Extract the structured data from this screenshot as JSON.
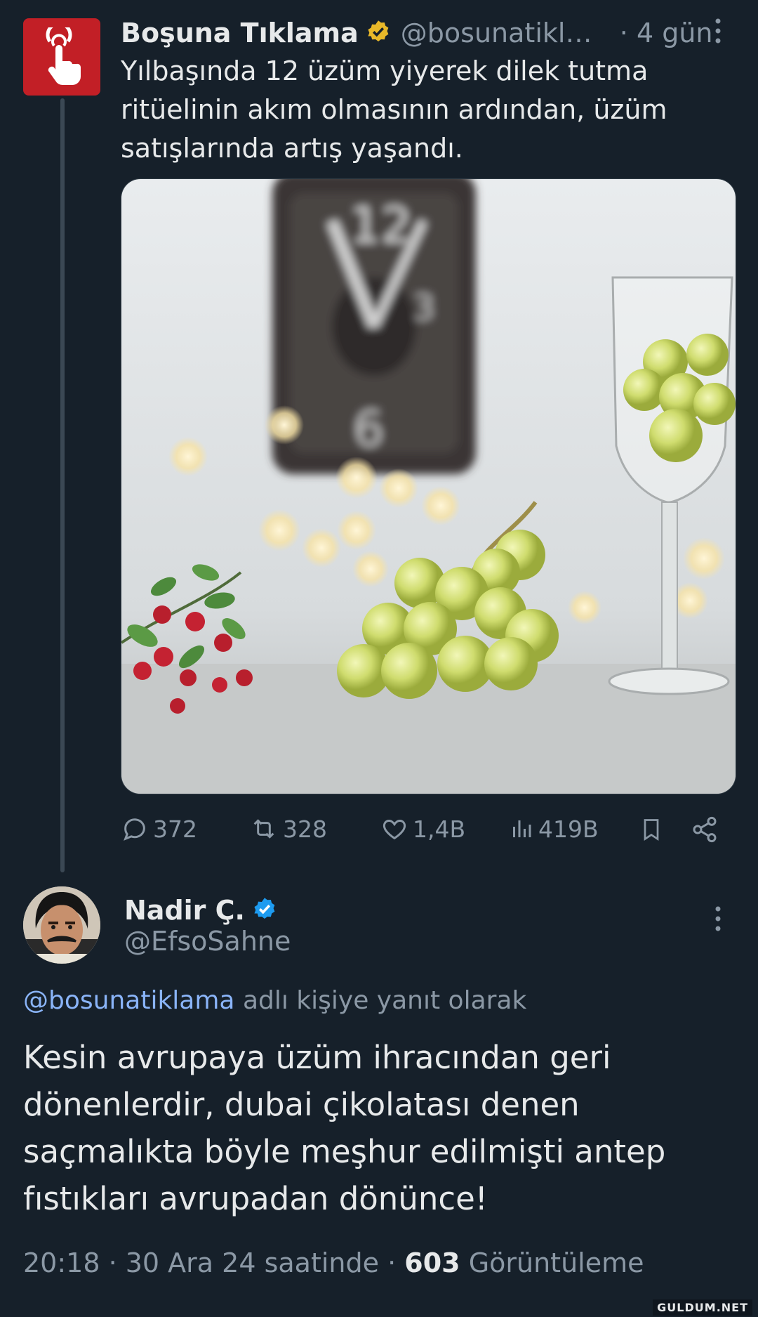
{
  "tweet": {
    "author_name": "Boşuna Tıklama",
    "author_handle": "@bosunatikla...",
    "time": "· 4 gün",
    "text": "Yılbaşında 12 üzüm yiyerek dilek tutma ritüelinin akım olmasının ardından, üzüm satışlarında artış yaşandı.",
    "verified_badge_color": "#e8b829",
    "avatar_color": "#c21f26",
    "stats": {
      "replies": "372",
      "retweets": "328",
      "likes": "1,4B",
      "views": "419B"
    },
    "icons": [
      "hand-pointer-icon",
      "verified-gold-icon",
      "more-icon",
      "reply-icon",
      "retweet-icon",
      "like-icon",
      "views-icon",
      "bookmark-icon",
      "share-icon"
    ]
  },
  "reply": {
    "author_name": "Nadir Ç.",
    "author_handle": "@EfsoSahne",
    "verified_badge_color": "#1d9bf0",
    "reply_mention": "@bosunatiklama",
    "reply_suffix": "adlı kişiye yanıt olarak",
    "text": "Kesin avrupaya üzüm ihracından geri dönenlerdir, dubai çikolatası denen saçmalıkta böyle meşhur edilmişti antep fıstıkları avrupadan dönünce!",
    "meta_prefix": "20:18 · 30 Ara 24 saatinde ·",
    "views_count": "603",
    "views_label": "Görüntüleme"
  },
  "watermark": "GULDUM.NET"
}
